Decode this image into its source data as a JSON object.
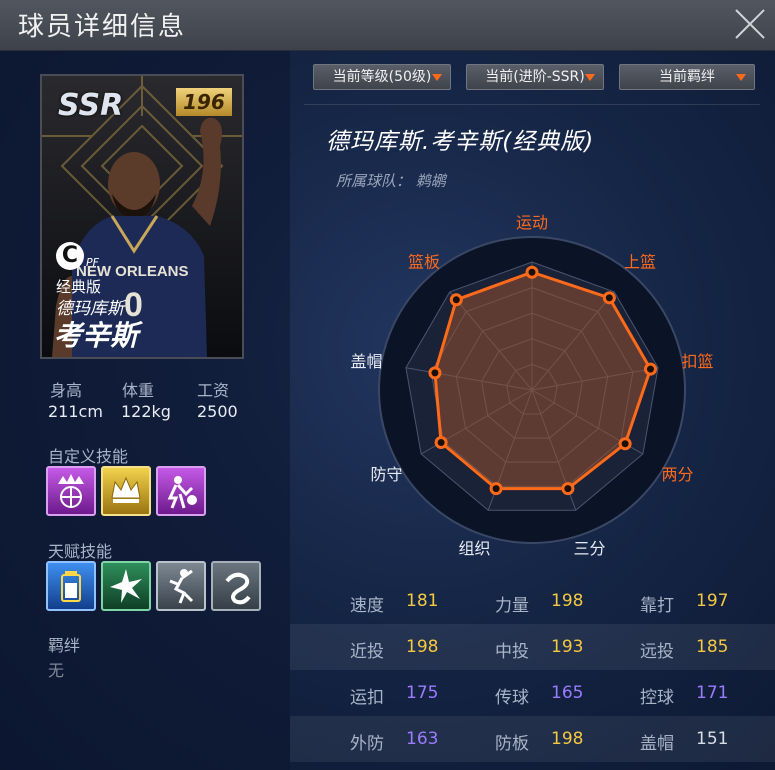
{
  "window": {
    "title": "球员详细信息"
  },
  "card": {
    "rarity": "SSR",
    "rating": "196",
    "grade": "C",
    "position": "PF",
    "edition": "经典版",
    "first_name": "德玛库斯",
    "last_name": "考辛斯",
    "jersey_text": "NEW ORLEANS",
    "jersey_number": "0"
  },
  "basic_stats": [
    {
      "label": "身高",
      "value": "211cm"
    },
    {
      "label": "体重",
      "value": "122kg"
    },
    {
      "label": "工资",
      "value": "2500"
    }
  ],
  "custom_skills_label": "自定义技能",
  "custom_skills": [
    {
      "icon": "crown-basketball-icon",
      "color": "#9b2fc0"
    },
    {
      "icon": "gold-crown-icon",
      "color": "#c9a21e"
    },
    {
      "icon": "player-dunk-icon",
      "color": "#a330c0"
    }
  ],
  "talent_skills_label": "天赋技能",
  "talent_skills": [
    {
      "icon": "battery-icon",
      "color": "#1f6ad1"
    },
    {
      "icon": "starburst-icon",
      "color": "#2a8a58"
    },
    {
      "icon": "player-jump-icon",
      "color": "#5e6a76"
    },
    {
      "icon": "swirl-icon",
      "color": "#4e5963"
    }
  ],
  "bond": {
    "label": "羁绊",
    "value": "无"
  },
  "dropdowns": [
    {
      "label": "当前等级(50级)"
    },
    {
      "label": "当前(进阶-SSR)"
    },
    {
      "label": "当前羁绊"
    }
  ],
  "player_name": "德玛库斯.考辛斯(经典版)",
  "team": "所属球队： 鹈鹕",
  "radar": {
    "axes": [
      "运动",
      "上篮",
      "扣篮",
      "两分",
      "三分",
      "组织",
      "防守",
      "盖帽",
      "篮板"
    ],
    "highlighted": [
      true,
      true,
      true,
      true,
      false,
      false,
      false,
      false,
      true
    ],
    "values": [
      0.92,
      0.94,
      0.94,
      0.84,
      0.82,
      0.82,
      0.82,
      0.77,
      0.92
    ],
    "highlight_color": "#ff6a1a",
    "normal_color": "#e8ecf4"
  },
  "attributes": [
    {
      "label": "速度",
      "value": "181",
      "color": "#f5c842"
    },
    {
      "label": "力量",
      "value": "198",
      "color": "#f5c842"
    },
    {
      "label": "靠打",
      "value": "197",
      "color": "#f5c842"
    },
    {
      "label": "近投",
      "value": "198",
      "color": "#f5c842"
    },
    {
      "label": "中投",
      "value": "193",
      "color": "#f5c842"
    },
    {
      "label": "远投",
      "value": "185",
      "color": "#f5c842"
    },
    {
      "label": "运扣",
      "value": "175",
      "color": "#9b7bff"
    },
    {
      "label": "传球",
      "value": "165",
      "color": "#9b7bff"
    },
    {
      "label": "控球",
      "value": "171",
      "color": "#9b7bff"
    },
    {
      "label": "外防",
      "value": "163",
      "color": "#9b7bff"
    },
    {
      "label": "防板",
      "value": "198",
      "color": "#f5c842"
    },
    {
      "label": "盖帽",
      "value": "151",
      "color": "#d8dde6"
    }
  ]
}
